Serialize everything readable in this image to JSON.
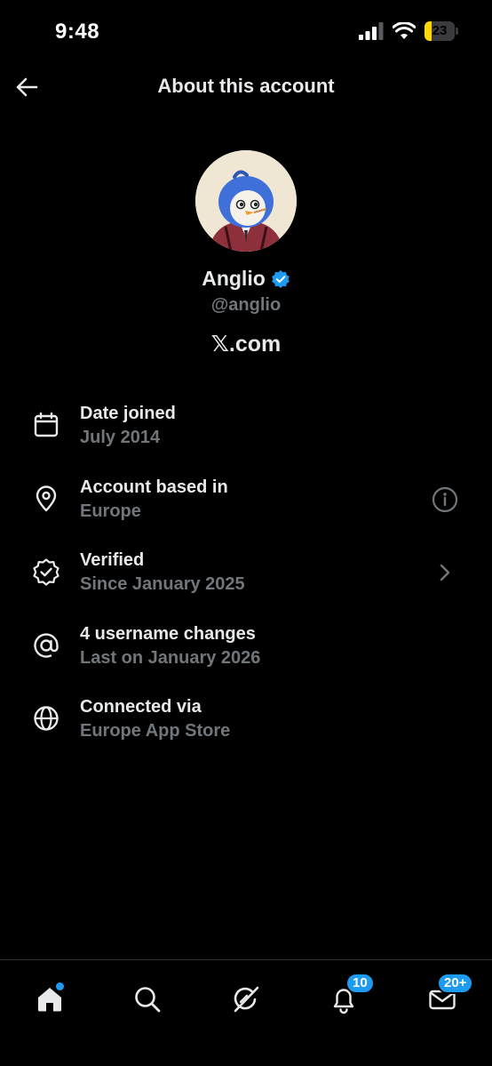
{
  "status_bar": {
    "time": "9:48",
    "battery_level": "23",
    "battery_fraction": 0.23
  },
  "header": {
    "title": "About this account"
  },
  "profile": {
    "name": "Anglio",
    "handle": "@anglio",
    "domain": "𝕏.com"
  },
  "info": {
    "date_joined": {
      "label": "Date joined",
      "value": "July 2014"
    },
    "based_in": {
      "label": "Account based in",
      "value": "Europe"
    },
    "verified": {
      "label": "Verified",
      "value": "Since January 2025"
    },
    "username_changes": {
      "label": "4 username changes",
      "value": "Last on January 2026"
    },
    "connected_via": {
      "label": "Connected via",
      "value": "Europe App Store"
    }
  },
  "nav": {
    "notifications_badge": "10",
    "messages_badge": "20+"
  },
  "colors": {
    "accent": "#1d9bf0",
    "muted": "#71767b",
    "text": "#e7e9ea",
    "battery": "#ffd60a"
  }
}
